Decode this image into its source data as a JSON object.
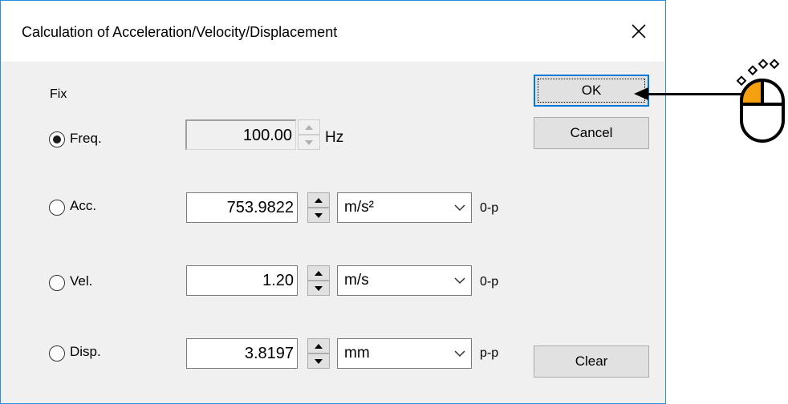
{
  "dialog": {
    "title": "Calculation of Acceleration/Velocity/Displacement",
    "close_glyph": "✕"
  },
  "fix_label": "Fix",
  "rows": [
    {
      "label": "Freq.",
      "checked": true,
      "value": "100.00",
      "unit": "Hz",
      "enabled": false
    },
    {
      "label": "Acc.",
      "checked": false,
      "value": "753.9822",
      "unit": "m/s²",
      "suffix": "0-p",
      "enabled": true
    },
    {
      "label": "Vel.",
      "checked": false,
      "value": "1.20",
      "unit": "m/s",
      "suffix": "0-p",
      "enabled": true
    },
    {
      "label": "Disp.",
      "checked": false,
      "value": "3.8197",
      "unit": "mm",
      "suffix": "p-p",
      "enabled": true
    }
  ],
  "buttons": {
    "ok": "OK",
    "cancel": "Cancel",
    "clear": "Clear"
  },
  "icons": [
    "close-icon",
    "spin-up-icon",
    "spin-down-icon",
    "chevron-down-icon",
    "arrow-left-icon",
    "mouse-click-icon"
  ],
  "colors": {
    "accent": "#0078d7",
    "mouse_highlight": "#f5a00f",
    "dialog_bg": "#f0f0f0",
    "border": "#2b8de0"
  }
}
